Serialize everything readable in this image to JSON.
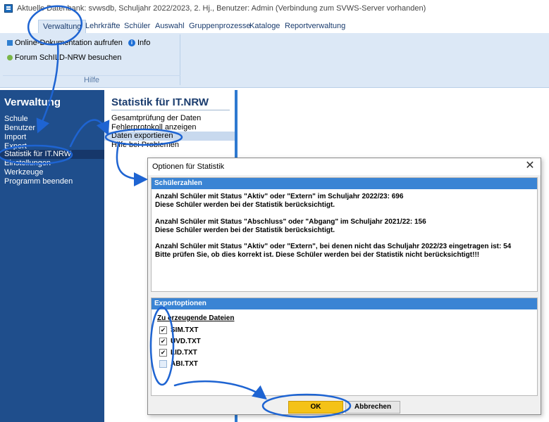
{
  "window": {
    "title": "Aktuelle Datenbank: svwsdb, Schuljahr 2022/2023, 2. Hj., Benutzer: Admin (Verbindung zum SVWS-Server vorhanden)"
  },
  "menu": {
    "tabs": [
      {
        "label": "Verwaltung",
        "active": true
      },
      {
        "label": "Lehrkräfte"
      },
      {
        "label": "Schüler"
      },
      {
        "label": "Auswahl"
      },
      {
        "label": "Gruppenprozesse"
      },
      {
        "label": "Kataloge"
      },
      {
        "label": "Reportverwaltung"
      }
    ]
  },
  "ribbon": {
    "online_doc": "Online-Dokumentation aufrufen",
    "info": "Info",
    "forum": "Forum SchILD-NRW besuchen",
    "group_label": "Hilfe"
  },
  "leftnav": {
    "title": "Verwaltung",
    "items": [
      {
        "label": "Schule"
      },
      {
        "label": "Benutzer"
      },
      {
        "label": "Import"
      },
      {
        "label": "Export"
      },
      {
        "label": "Statistik für IT.NRW",
        "selected": true
      },
      {
        "label": "Einstellungen"
      },
      {
        "label": "Werkzeuge"
      },
      {
        "label": "Programm beenden"
      }
    ]
  },
  "midpanel": {
    "title": "Statistik für IT.NRW",
    "items": [
      {
        "label": "Gesamtprüfung der Daten"
      },
      {
        "label": "Fehlerprotokoll anzeigen"
      },
      {
        "label": "Daten exportieren",
        "selected": true
      },
      {
        "label": "Hilfe bei Problemen"
      }
    ]
  },
  "dialog": {
    "title": "Optionen für Statistik",
    "close_glyph": "✕",
    "schuelerzahlen": {
      "heading": "Schülerzahlen",
      "lines": [
        "Anzahl Schüler mit Status \"Aktiv\" oder \"Extern\" im Schuljahr 2022/23: 696",
        "Diese Schüler werden bei der Statistik berücksichtigt.",
        "Anzahl Schüler mit Status \"Abschluss\" oder \"Abgang\" im Schuljahr 2021/22: 156",
        "Diese Schüler werden bei der Statistik berücksichtigt.",
        "Anzahl Schüler mit Status \"Aktiv\" oder \"Extern\", bei denen nicht das Schuljahr 2022/23 eingetragen ist: 54",
        "Bitte prüfen Sie, ob dies korrekt ist. Diese Schüler werden bei der Statistik nicht berücksichtigt!!!"
      ]
    },
    "exportoptionen": {
      "heading": "Exportoptionen",
      "files_label": "Zu erzeugende Dateien",
      "files": [
        {
          "label": "SIM.TXT",
          "checked": true
        },
        {
          "label": "UVD.TXT",
          "checked": true
        },
        {
          "label": "LID.TXT",
          "checked": true
        },
        {
          "label": "ABI.TXT",
          "checked": false
        }
      ]
    },
    "ok_label": "OK",
    "cancel_label": "Abbrechen"
  },
  "colors": {
    "nav_blue": "#1f4e8c",
    "section_header": "#3a84d4",
    "ok_button": "#f4c218",
    "annotation": "#1e64d2"
  }
}
